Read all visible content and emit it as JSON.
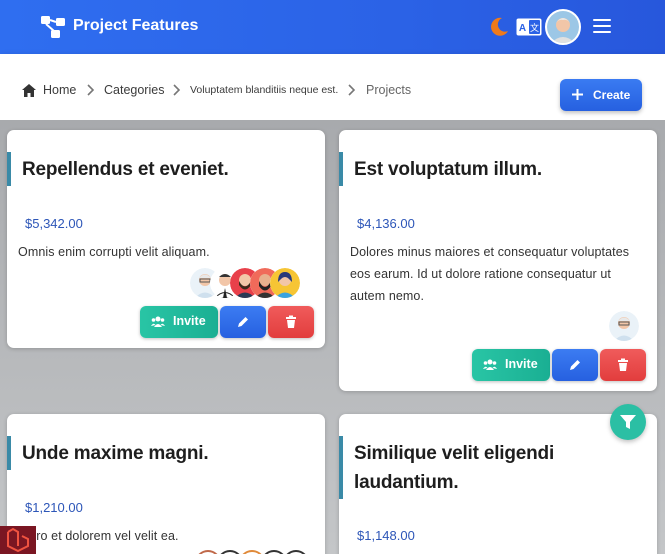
{
  "app": {
    "title": "Project Features"
  },
  "topbar": {
    "icons": {
      "logo": "graph-nodes-icon",
      "theme": "moon-icon",
      "language": "translate-icon",
      "menu": "hamburger-icon"
    }
  },
  "breadcrumb": {
    "items": [
      {
        "label": "Home"
      },
      {
        "label": "Categories"
      },
      {
        "label": "Voluptatem blanditiis neque est."
      },
      {
        "label": "Projects"
      }
    ]
  },
  "actions": {
    "create_label": "Create"
  },
  "colors": {
    "primary": "#2f6ef0",
    "invite": "#22bb9c",
    "danger": "#e84949",
    "accent_bar": "#3a8aa7",
    "price": "#2d56b8"
  },
  "projects": [
    {
      "title": "Repellendus et eveniet.",
      "price": "$5,342.00",
      "description": "Omnis enim corrupti velit aliquam.",
      "invite_label": "Invite",
      "members": [
        "avatar-man-glasses",
        "avatar-man-tie",
        "avatar-bearded-red",
        "avatar-bearded-dark",
        "avatar-woman-yellow"
      ]
    },
    {
      "title": "Est voluptatum illum.",
      "price": "$4,136.00",
      "description": "Dolores minus maiores et consequatur voluptates eos earum. Id ut dolore ratione consequatur ut autem nemo.",
      "invite_label": "Invite",
      "members": [
        "avatar-man-glasses"
      ]
    },
    {
      "title": "Unde maxime magni.",
      "price": "$1,210.00",
      "description": "rro et dolorem vel velit ea."
    },
    {
      "title": "Similique velit eligendi laudantium.",
      "price": "$1,148.00"
    }
  ]
}
